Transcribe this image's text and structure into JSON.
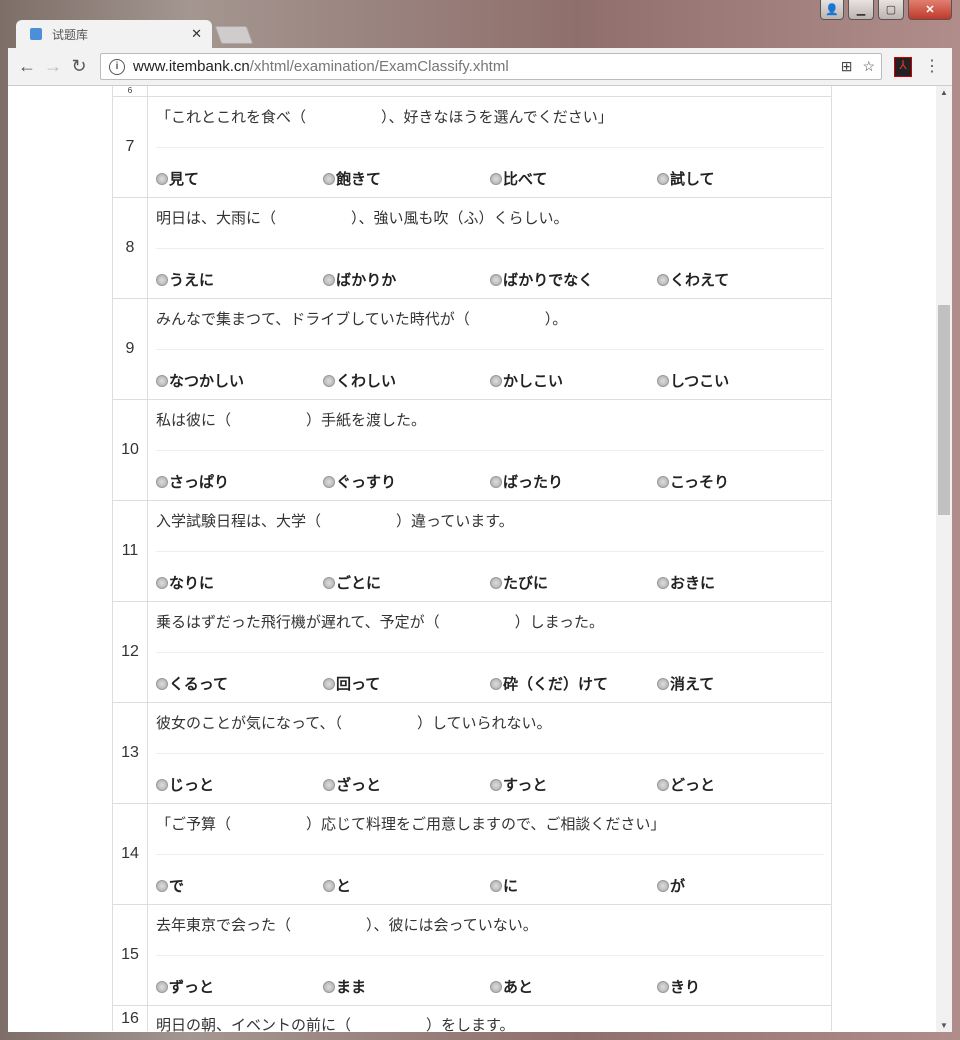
{
  "browser": {
    "tab_title": "试题库",
    "url_host": "www.itembank.cn",
    "url_path": "/xhtml/examination/ExamClassify.xhtml"
  },
  "questions": [
    {
      "num": "6",
      "text": "",
      "options": [
        "",
        "",
        "",
        ""
      ]
    },
    {
      "num": "7",
      "text": "「これとこれを食べ（　　　　　）、好きなほうを選んでください」",
      "options": [
        "見て",
        "飽きて",
        "比べて",
        "試して"
      ]
    },
    {
      "num": "8",
      "text": "明日は、大雨に（　　　　　）、強い風も吹（ふ）くらしい。",
      "options": [
        "うえに",
        "ばかりか",
        "ばかりでなく",
        "くわえて"
      ]
    },
    {
      "num": "9",
      "text": "みんなで集まつて、ドライブしていた時代が（　　　　　）。",
      "options": [
        "なつかしい",
        "くわしい",
        "かしこい",
        "しつこい"
      ]
    },
    {
      "num": "10",
      "text": "私は彼に（　　　　　）手紙を渡した。",
      "options": [
        "さっぱり",
        "ぐっすり",
        "ばったり",
        "こっそり"
      ]
    },
    {
      "num": "11",
      "text": "入学試験日程は、大学（　　　　　）違っています。",
      "options": [
        "なりに",
        "ごとに",
        "たびに",
        "おきに"
      ]
    },
    {
      "num": "12",
      "text": "乗るはずだった飛行機が遅れて、予定が（　　　　　）しまった。",
      "options": [
        "くるって",
        "回って",
        "砕（くだ）けて",
        "消えて"
      ]
    },
    {
      "num": "13",
      "text": "彼女のことが気になって、（　　　　　）していられない。",
      "options": [
        "じっと",
        "ざっと",
        "すっと",
        "どっと"
      ]
    },
    {
      "num": "14",
      "text": "「ご予算（　　　　　）応じて料理をご用意しますので、ご相談ください」",
      "options": [
        "で",
        "と",
        "に",
        "が"
      ]
    },
    {
      "num": "15",
      "text": "去年東京で会った（　　　　　）、彼には会っていない。",
      "options": [
        "ずっと",
        "まま",
        "あと",
        "きり"
      ]
    },
    {
      "num": "16",
      "text": "明日の朝、イベントの前に（　　　　　）をします。",
      "options": [
        "",
        "",
        "",
        ""
      ]
    }
  ]
}
